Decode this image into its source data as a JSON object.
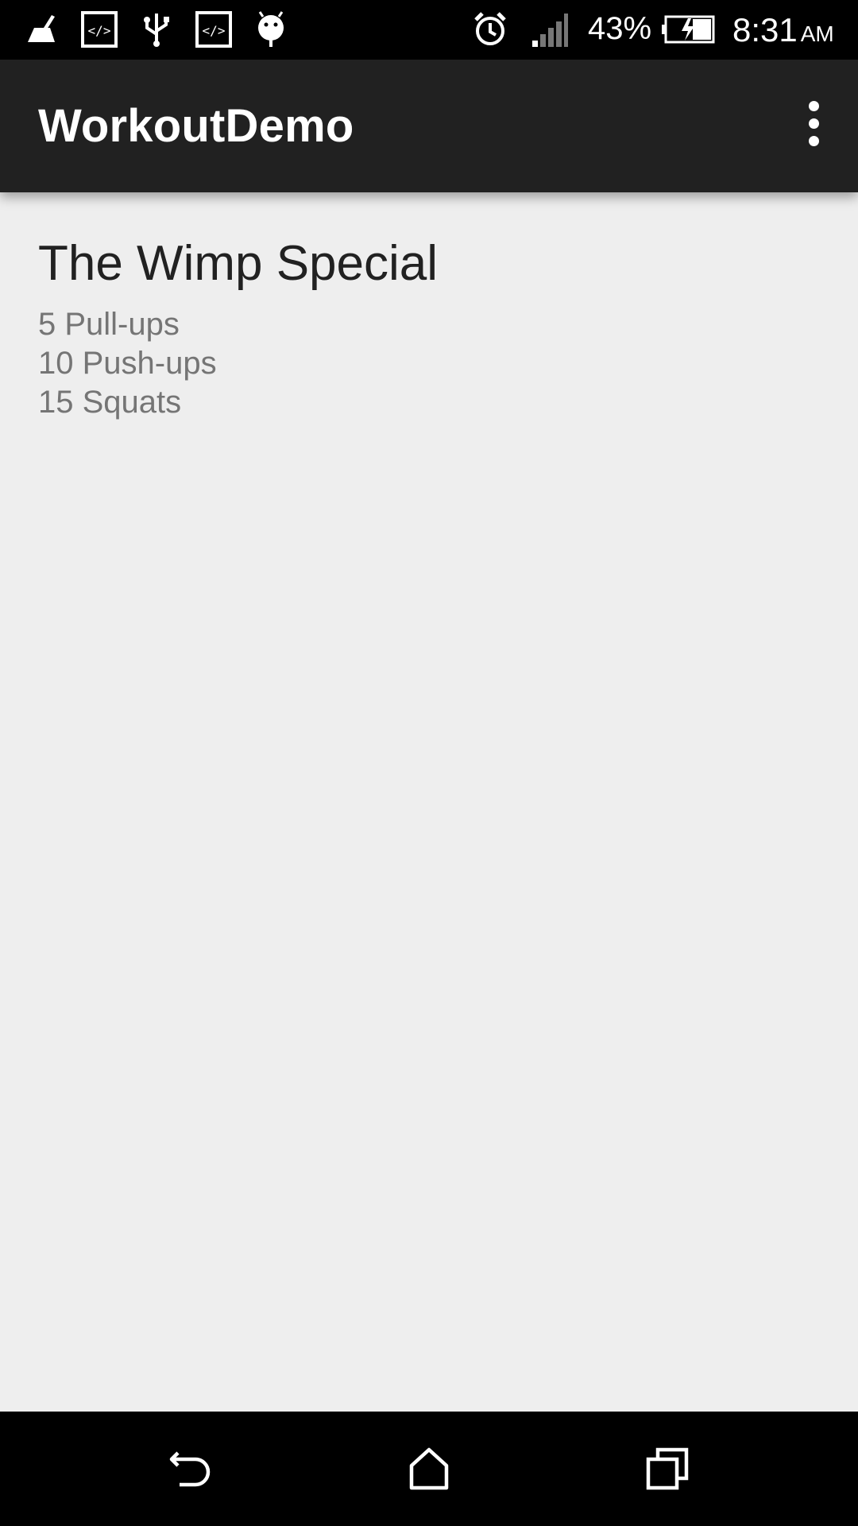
{
  "status_bar": {
    "left_icons": [
      "cleaner-icon",
      "code-icon",
      "usb-icon",
      "code-icon",
      "android-debug-icon"
    ],
    "right_icons": [
      "alarm-icon",
      "signal-icon",
      "battery-charging-icon"
    ],
    "battery_percent": "43%",
    "time": "8:31",
    "ampm": "AM"
  },
  "toolbar": {
    "title": "WorkoutDemo",
    "overflow_icon": "more-vert-icon"
  },
  "workout": {
    "title": "The Wimp Special",
    "exercises": [
      "5 Pull-ups",
      "10 Push-ups",
      "15 Squats"
    ]
  },
  "nav_bar": {
    "icons": [
      "back-icon",
      "home-icon",
      "recents-icon"
    ]
  },
  "colors": {
    "status_bar": "#000000",
    "toolbar": "#212121",
    "background": "#eeeeee",
    "title_text": "#212121",
    "secondary_text": "#757575",
    "nav_bar": "#000000"
  }
}
